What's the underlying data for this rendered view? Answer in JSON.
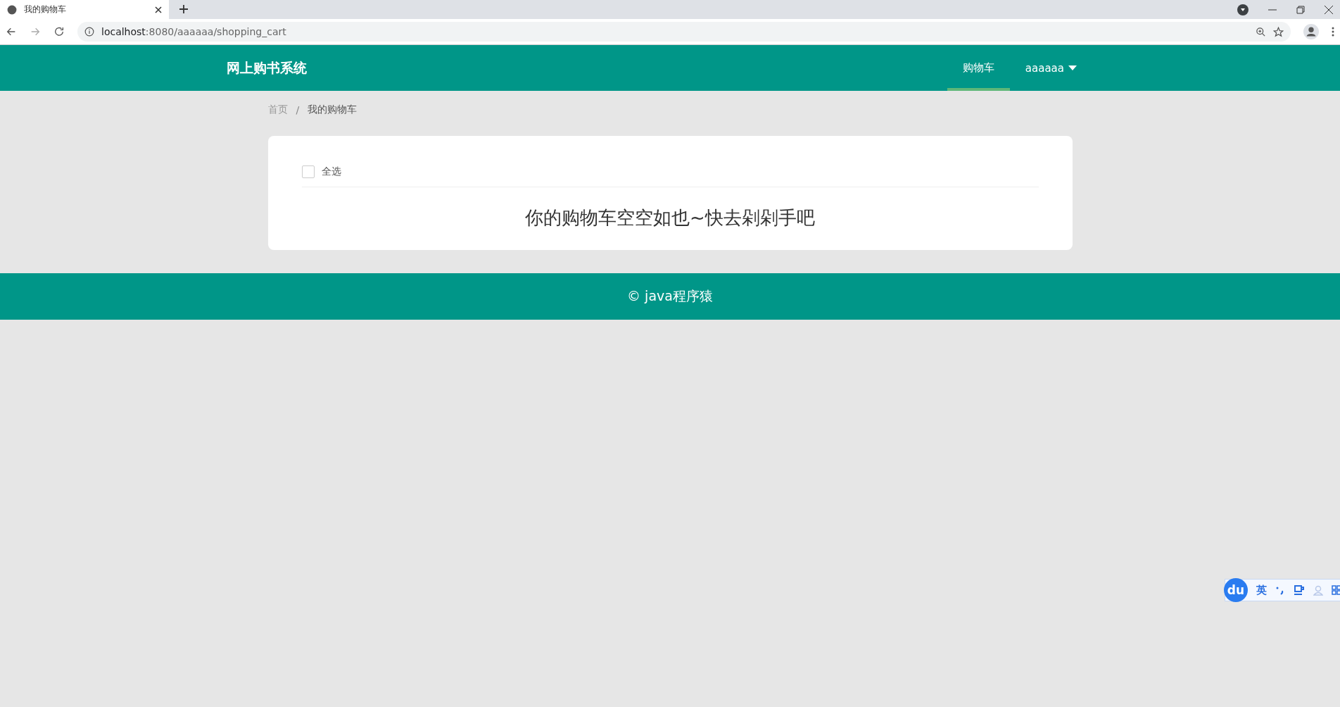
{
  "browser": {
    "tab_title": "我的购物车",
    "url_host": "localhost",
    "url_rest": ":8080/aaaaaa/shopping_cart"
  },
  "header": {
    "title": "网上购书系统",
    "nav": [
      {
        "label": "购物车",
        "selected": true
      },
      {
        "label": "aaaaaa",
        "kind": "dropdown",
        "selected": false
      }
    ]
  },
  "breadcrumb": {
    "items": [
      "首页",
      "我的购物车"
    ],
    "separator": "/"
  },
  "cart": {
    "select_all": {
      "label": "全选",
      "checked": false
    },
    "empty_message": "你的购物车空空如也~快去剁剁手吧"
  },
  "footer": {
    "text": "© java程序猿"
  },
  "ime_toolbar": {
    "logo": "du",
    "mode": "英"
  }
}
